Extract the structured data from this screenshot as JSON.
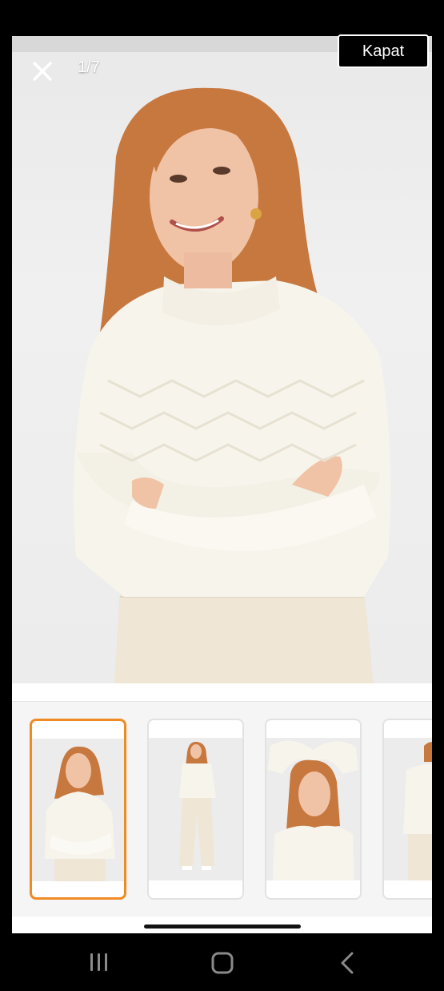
{
  "gallery": {
    "counter": "1/7",
    "close_label": "Kapat"
  },
  "thumbnails": [
    {
      "label": "front-crossed-arms",
      "selected": true
    },
    {
      "label": "full-body",
      "selected": false
    },
    {
      "label": "hands-on-head",
      "selected": false
    },
    {
      "label": "back-view",
      "selected": false
    }
  ],
  "icons": {
    "close": "close-icon",
    "recents": "recents-icon",
    "home": "home-icon",
    "back": "back-icon"
  },
  "colors": {
    "accent": "#f08a24",
    "sweater": "#f7f4ec",
    "hair": "#c7783f",
    "skin": "#f1c3a6"
  }
}
